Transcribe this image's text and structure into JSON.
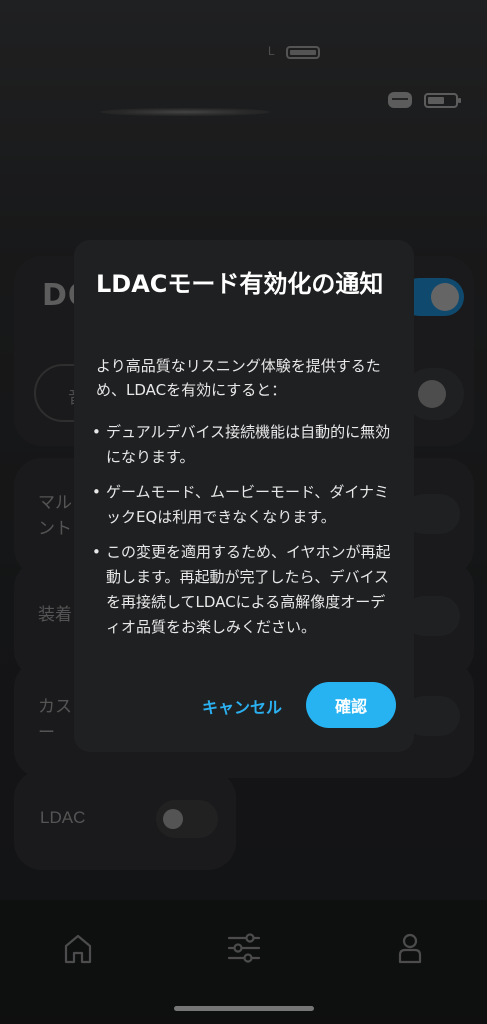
{
  "background": {
    "earbud_left_marker": "L",
    "brand_partial": "DO",
    "mode_pill_partial": "音",
    "multipoint_label_partial": [
      "マル",
      "ント"
    ],
    "wear_detection_partial": "装着",
    "custom_partial": [
      "カス",
      "ー"
    ],
    "ldac_label": "LDAC"
  },
  "dialog": {
    "title": "LDACモード有効化の通知",
    "intro": "より高品質なリスニング体験を提供するため、LDACを有効にすると：",
    "bullets": [
      "デュアルデバイス接続機能は自動的に無効になります。",
      "ゲームモード、ムービーモード、ダイナミックEQは利用できなくなります。",
      "この変更を適用するため、イヤホンが再起動します。再起動が完了したら、デバイスを再接続してLDACによる高解像度オーディオ品質をお楽しみください。"
    ],
    "cancel_label": "キャンセル",
    "confirm_label": "確認"
  },
  "nav": {
    "items": [
      "home-icon",
      "equalizer-icon",
      "profile-icon"
    ]
  },
  "colors": {
    "accent": "#27b3f1",
    "dialog_bg": "#1f2022",
    "background": "#262729"
  }
}
